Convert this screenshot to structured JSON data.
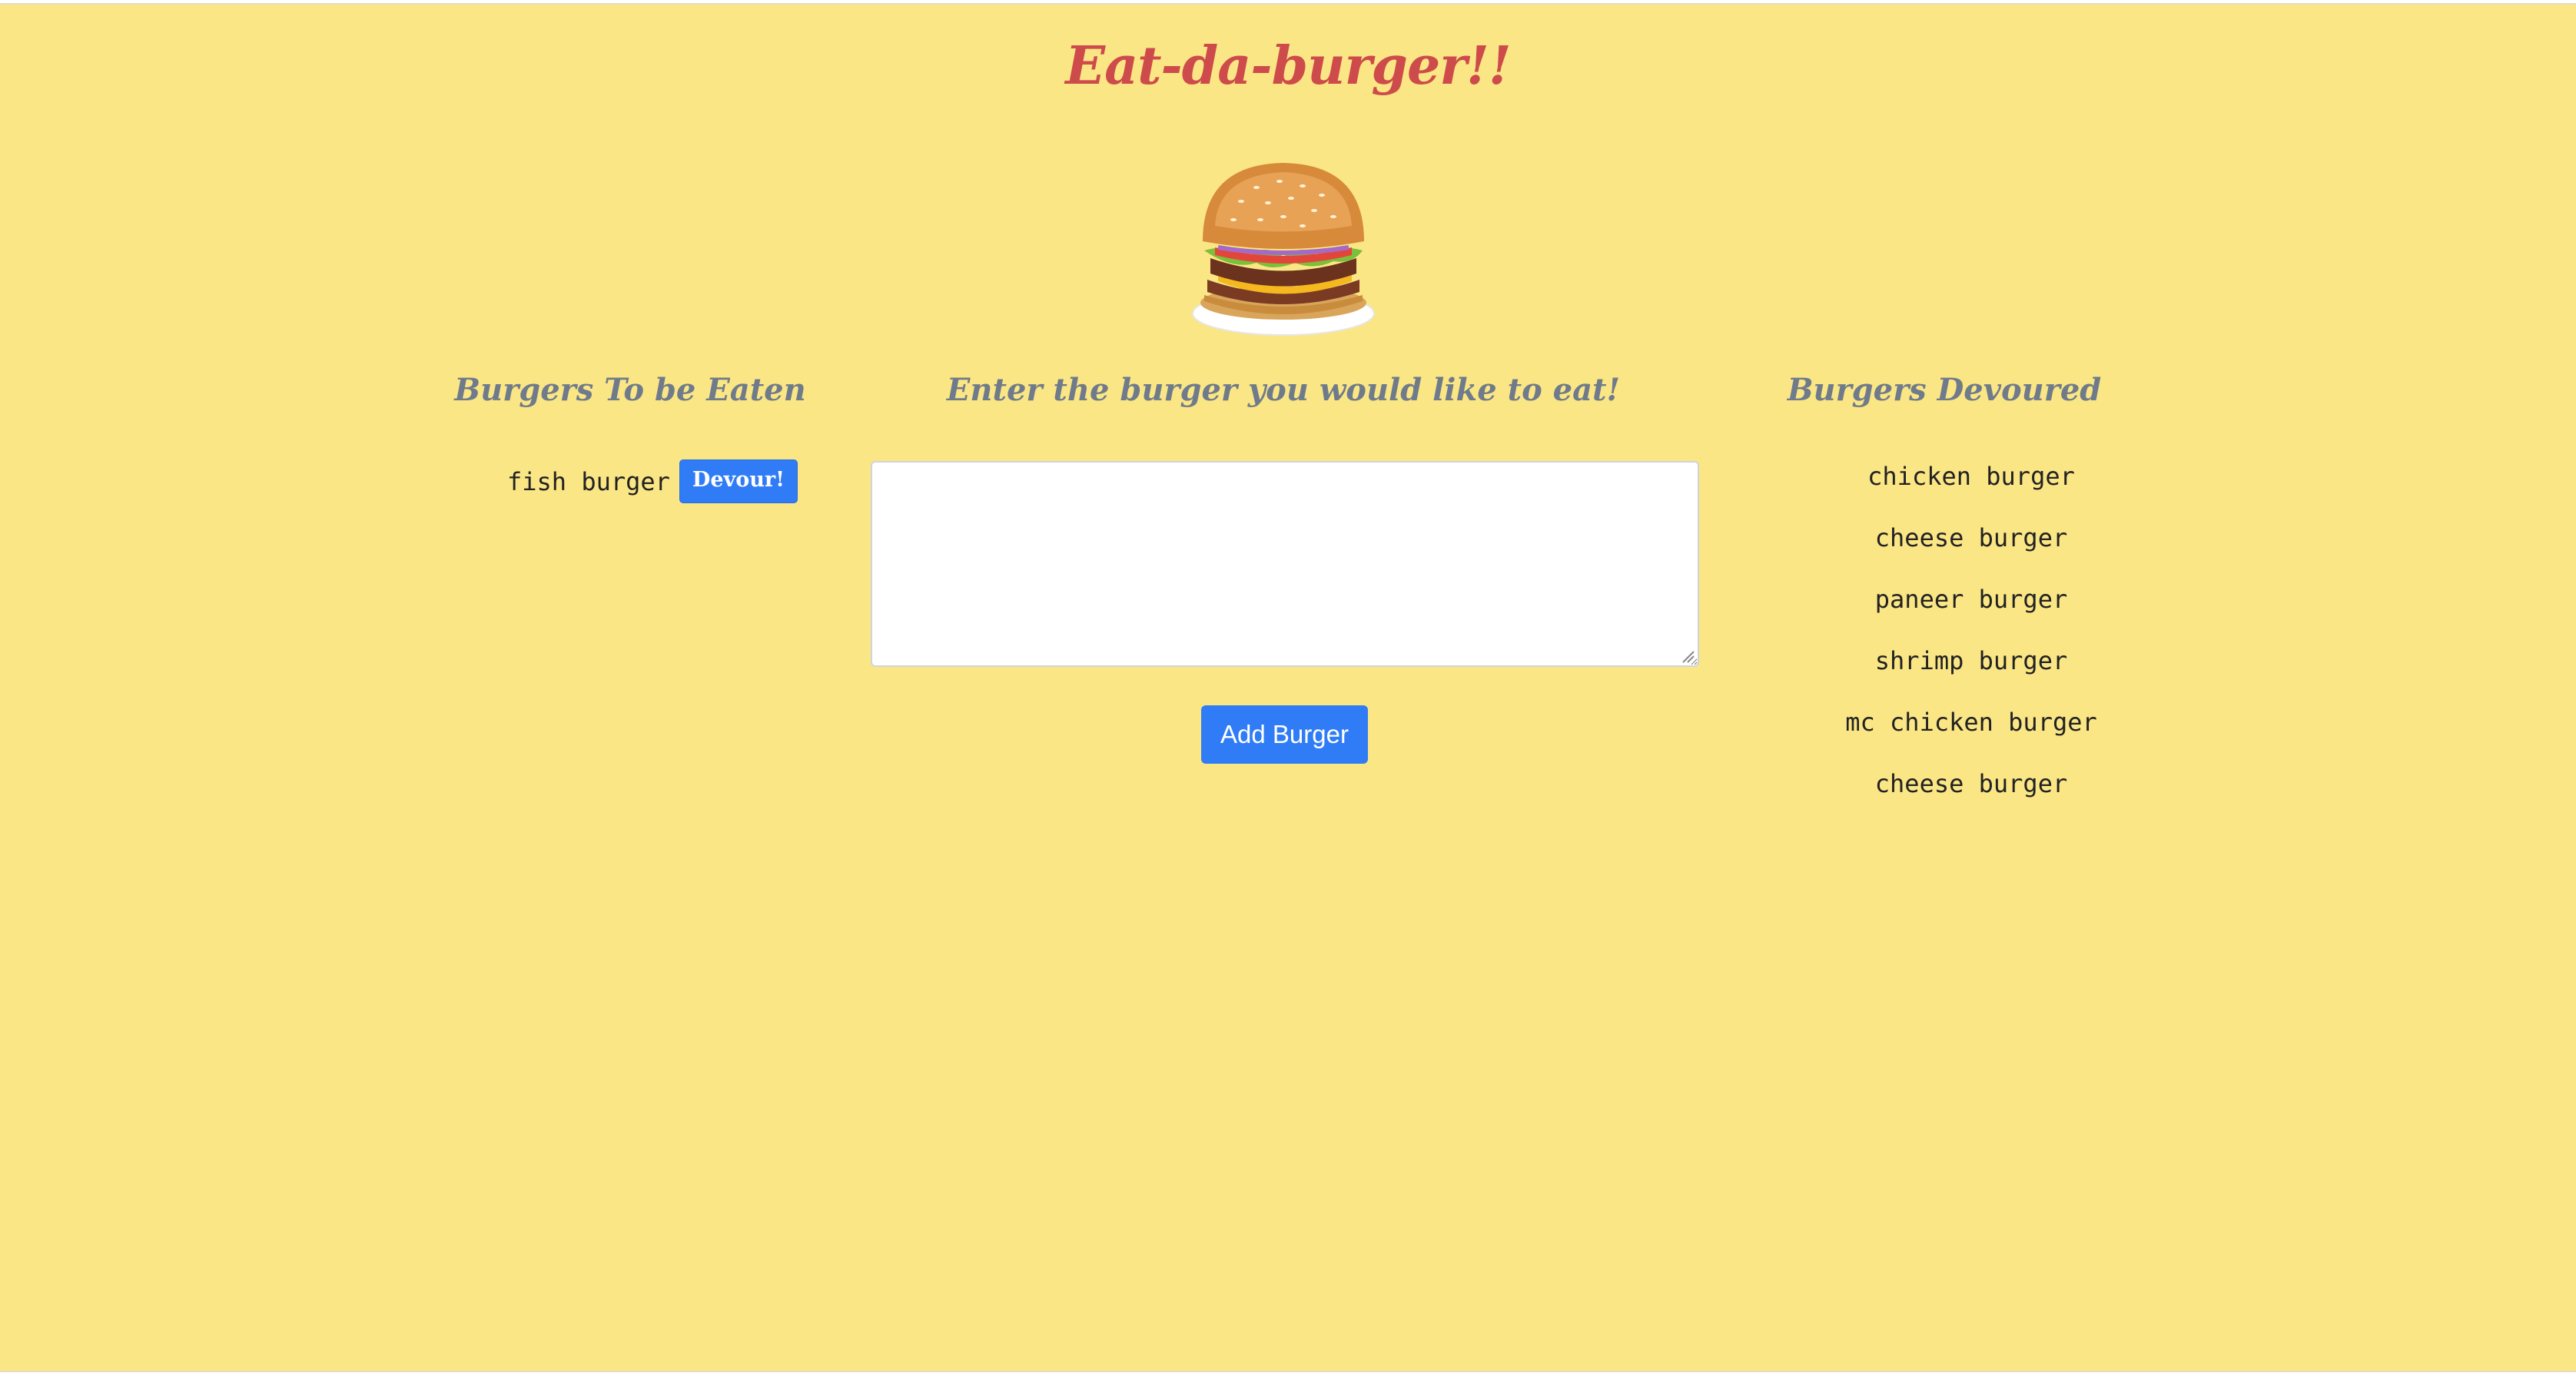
{
  "header": {
    "title": "Eat-da-burger!!",
    "logo_icon": "burger-icon"
  },
  "left_column": {
    "heading": "Burgers To be Eaten",
    "items": [
      {
        "name": "fish burger",
        "button_label": "Devour!"
      }
    ]
  },
  "middle_column": {
    "heading": "Enter the burger you would like to eat!",
    "input_value": "",
    "button_label": "Add Burger"
  },
  "right_column": {
    "heading": "Burgers Devoured",
    "items": [
      "chicken burger",
      "cheese burger",
      "paneer burger",
      "shrimp burger",
      "mc chicken burger",
      "cheese burger"
    ]
  },
  "colors": {
    "background": "#fbe685",
    "title": "#cd4b4b",
    "heading": "#6f7b8a",
    "button": "#2f7cf6"
  }
}
